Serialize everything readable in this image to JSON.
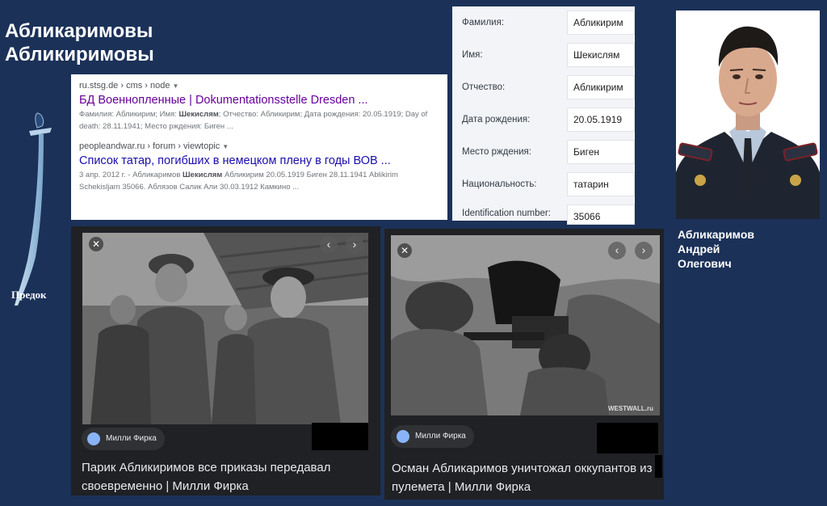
{
  "heading": {
    "line1": "Абликаримовы",
    "line2": "Абликиримовы"
  },
  "ancestor": {
    "label": "Предок"
  },
  "search_results": [
    {
      "breadcrumb": "ru.stsg.de › cms › node",
      "title": "БД Военнопленные | Dokumentationsstelle Dresden ...",
      "snippet_prefix": "Фамилия: Абликирим; Имя: ",
      "snippet_bold": "Шекислям",
      "snippet_suffix": "; Отчество: Абликирим; Дата рождения: 20.05.1919; Day of death: 28.11.1941; Место рждения: Биген ..."
    },
    {
      "breadcrumb": "peopleandwar.ru › forum › viewtopic",
      "title": "Список татар, погибших в немецком плену в годы ВОВ ...",
      "snippet_prefix": "3 апр. 2012 г. - Абликаримов ",
      "snippet_bold": "Шекислям",
      "snippet_suffix": " Абликирим 20.05.1919 Биген 28.11.1941 Ablikirim Schekisljam 35066. Аблязов Салик Али 30.03.1912 Камкино ..."
    }
  ],
  "record": [
    {
      "label": "Фамилия:",
      "value": "Абликирим"
    },
    {
      "label": "Имя:",
      "value": "Шекислям"
    },
    {
      "label": "Отчество:",
      "value": "Абликирим"
    },
    {
      "label": "Дата рождения:",
      "value": "20.05.1919"
    },
    {
      "label": "Место рждения:",
      "value": "Биген"
    },
    {
      "label": "Национальность:",
      "value": "татарин"
    },
    {
      "label": "Identification number:",
      "value": "35066"
    }
  ],
  "person": {
    "line1": "Абликаримов",
    "line2": "Андрей",
    "line3": "Олегович"
  },
  "cards": [
    {
      "source": "Милли Фирка",
      "caption": "Парик Абликиримов все приказы передавал своевременно | Милли Фирка"
    },
    {
      "source": "Милли Фирка",
      "caption": "Осман Абликаримов уничтожал оккупантов из пулемета | Милли Фирка",
      "watermark": "WESTWALL.ru"
    }
  ],
  "icons": {
    "close": "close-icon",
    "prev": "chevron-left-icon",
    "next": "chevron-right-icon",
    "globe": "globe-icon"
  },
  "colors": {
    "background": "#1b3158",
    "link": "#1a0dab",
    "link_visited": "#660099",
    "card_bg": "#202124"
  }
}
